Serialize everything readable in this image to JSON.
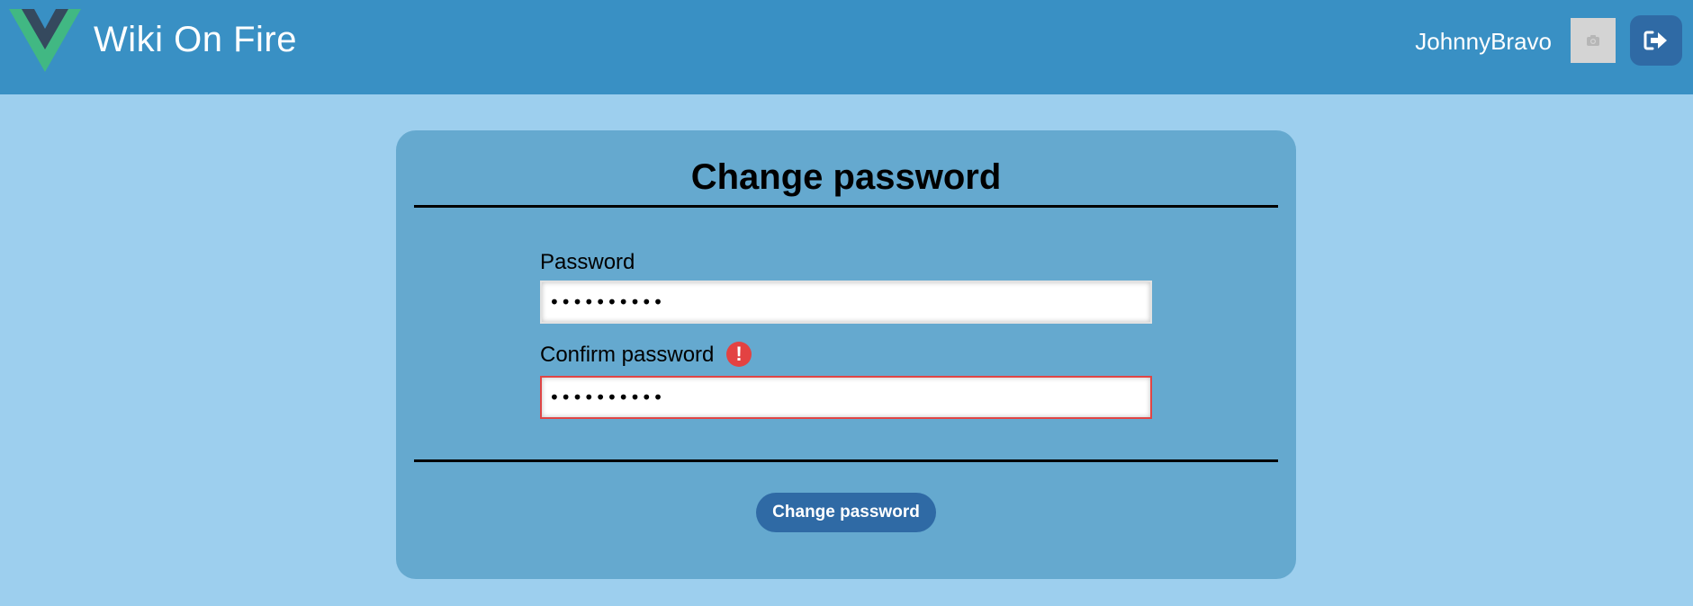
{
  "header": {
    "app_title": "Wiki On Fire",
    "username": "JohnnyBravo",
    "logo_icon": "vue-logo-icon",
    "avatar_icon": "camera-icon",
    "logout_icon": "sign-out-icon"
  },
  "form": {
    "title": "Change password",
    "password_label": "Password",
    "password_value": "••••••••••",
    "confirm_label": "Confirm password",
    "confirm_value": "••••••••••",
    "error_icon": "exclamation-icon",
    "submit_label": "Change password"
  },
  "colors": {
    "page_background": "#9dcfee",
    "header_background": "#3990c4",
    "card_background": "#65a9cf",
    "button_background": "#2f6aa5",
    "error": "#e34242",
    "logo_green": "#41b883",
    "logo_dark": "#35495e"
  }
}
